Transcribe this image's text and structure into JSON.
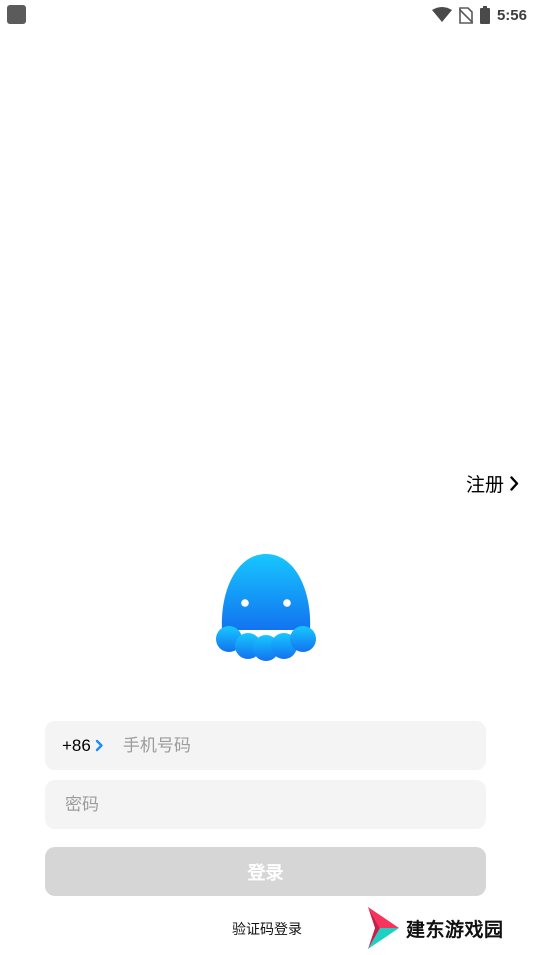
{
  "status_bar": {
    "time": "5:56",
    "icons": [
      "app-notification-icon",
      "wifi-icon",
      "no-sim-icon",
      "battery-icon"
    ]
  },
  "register": {
    "label": "注册"
  },
  "login_form": {
    "country_code": "+86",
    "phone_placeholder": "手机号码",
    "phone_value": "",
    "password_placeholder": "密码",
    "password_value": "",
    "login_button": "登录",
    "sms_login": "验证码登录"
  },
  "logo": {
    "icon": "octopus-logo",
    "color": "#1c8cf8"
  },
  "watermark": {
    "text": "建东游戏园"
  },
  "colors": {
    "background": "#ffffff",
    "field_background": "#f4f4f4",
    "button_disabled": "#d6d6d6",
    "accent": "#1c8cf8"
  }
}
